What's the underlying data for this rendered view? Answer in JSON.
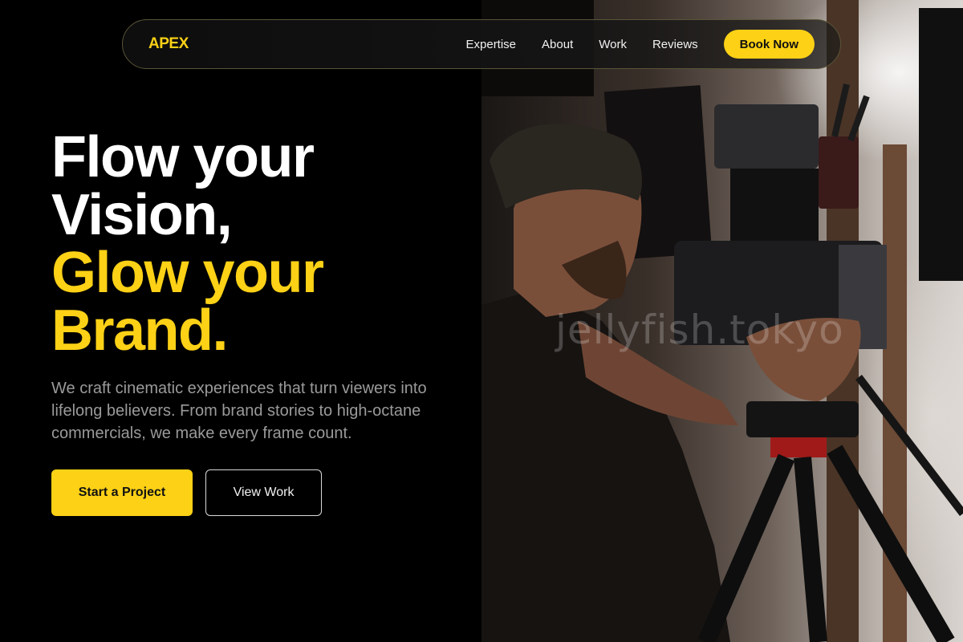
{
  "nav": {
    "logo": "APEX",
    "links": [
      "Expertise",
      "About",
      "Work",
      "Reviews"
    ],
    "cta": "Book Now"
  },
  "hero": {
    "headline_white": [
      "Flow your",
      "Vision,"
    ],
    "headline_yellow": [
      "Glow your",
      "Brand."
    ],
    "subtitle": "We craft cinematic experiences that turn viewers into lifelong believers. From brand stories to high-octane commercials, we make every frame count.",
    "primary_cta": "Start a Project",
    "secondary_cta": "View Work",
    "image": {
      "description_icon": "camera-operator-photo",
      "watermark": "jellyfish.tokyo"
    }
  },
  "colors": {
    "accent": "#fcd116",
    "background": "#000000",
    "text": "#ffffff",
    "muted": "#9a9a9a"
  }
}
